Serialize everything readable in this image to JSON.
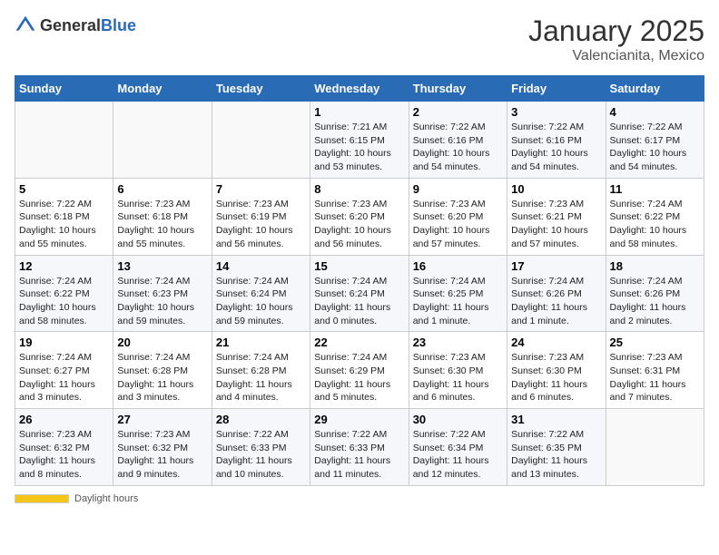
{
  "header": {
    "logo_general": "General",
    "logo_blue": "Blue",
    "month": "January 2025",
    "location": "Valencianita, Mexico"
  },
  "days_of_week": [
    "Sunday",
    "Monday",
    "Tuesday",
    "Wednesday",
    "Thursday",
    "Friday",
    "Saturday"
  ],
  "weeks": [
    [
      {
        "day": "",
        "sunrise": "",
        "sunset": "",
        "daylight": ""
      },
      {
        "day": "",
        "sunrise": "",
        "sunset": "",
        "daylight": ""
      },
      {
        "day": "",
        "sunrise": "",
        "sunset": "",
        "daylight": ""
      },
      {
        "day": "1",
        "sunrise": "7:21 AM",
        "sunset": "6:15 PM",
        "daylight": "10 hours and 53 minutes."
      },
      {
        "day": "2",
        "sunrise": "7:22 AM",
        "sunset": "6:16 PM",
        "daylight": "10 hours and 54 minutes."
      },
      {
        "day": "3",
        "sunrise": "7:22 AM",
        "sunset": "6:16 PM",
        "daylight": "10 hours and 54 minutes."
      },
      {
        "day": "4",
        "sunrise": "7:22 AM",
        "sunset": "6:17 PM",
        "daylight": "10 hours and 54 minutes."
      }
    ],
    [
      {
        "day": "5",
        "sunrise": "7:22 AM",
        "sunset": "6:18 PM",
        "daylight": "10 hours and 55 minutes."
      },
      {
        "day": "6",
        "sunrise": "7:23 AM",
        "sunset": "6:18 PM",
        "daylight": "10 hours and 55 minutes."
      },
      {
        "day": "7",
        "sunrise": "7:23 AM",
        "sunset": "6:19 PM",
        "daylight": "10 hours and 56 minutes."
      },
      {
        "day": "8",
        "sunrise": "7:23 AM",
        "sunset": "6:20 PM",
        "daylight": "10 hours and 56 minutes."
      },
      {
        "day": "9",
        "sunrise": "7:23 AM",
        "sunset": "6:20 PM",
        "daylight": "10 hours and 57 minutes."
      },
      {
        "day": "10",
        "sunrise": "7:23 AM",
        "sunset": "6:21 PM",
        "daylight": "10 hours and 57 minutes."
      },
      {
        "day": "11",
        "sunrise": "7:24 AM",
        "sunset": "6:22 PM",
        "daylight": "10 hours and 58 minutes."
      }
    ],
    [
      {
        "day": "12",
        "sunrise": "7:24 AM",
        "sunset": "6:22 PM",
        "daylight": "10 hours and 58 minutes."
      },
      {
        "day": "13",
        "sunrise": "7:24 AM",
        "sunset": "6:23 PM",
        "daylight": "10 hours and 59 minutes."
      },
      {
        "day": "14",
        "sunrise": "7:24 AM",
        "sunset": "6:24 PM",
        "daylight": "10 hours and 59 minutes."
      },
      {
        "day": "15",
        "sunrise": "7:24 AM",
        "sunset": "6:24 PM",
        "daylight": "11 hours and 0 minutes."
      },
      {
        "day": "16",
        "sunrise": "7:24 AM",
        "sunset": "6:25 PM",
        "daylight": "11 hours and 1 minute."
      },
      {
        "day": "17",
        "sunrise": "7:24 AM",
        "sunset": "6:26 PM",
        "daylight": "11 hours and 1 minute."
      },
      {
        "day": "18",
        "sunrise": "7:24 AM",
        "sunset": "6:26 PM",
        "daylight": "11 hours and 2 minutes."
      }
    ],
    [
      {
        "day": "19",
        "sunrise": "7:24 AM",
        "sunset": "6:27 PM",
        "daylight": "11 hours and 3 minutes."
      },
      {
        "day": "20",
        "sunrise": "7:24 AM",
        "sunset": "6:28 PM",
        "daylight": "11 hours and 3 minutes."
      },
      {
        "day": "21",
        "sunrise": "7:24 AM",
        "sunset": "6:28 PM",
        "daylight": "11 hours and 4 minutes."
      },
      {
        "day": "22",
        "sunrise": "7:24 AM",
        "sunset": "6:29 PM",
        "daylight": "11 hours and 5 minutes."
      },
      {
        "day": "23",
        "sunrise": "7:23 AM",
        "sunset": "6:30 PM",
        "daylight": "11 hours and 6 minutes."
      },
      {
        "day": "24",
        "sunrise": "7:23 AM",
        "sunset": "6:30 PM",
        "daylight": "11 hours and 6 minutes."
      },
      {
        "day": "25",
        "sunrise": "7:23 AM",
        "sunset": "6:31 PM",
        "daylight": "11 hours and 7 minutes."
      }
    ],
    [
      {
        "day": "26",
        "sunrise": "7:23 AM",
        "sunset": "6:32 PM",
        "daylight": "11 hours and 8 minutes."
      },
      {
        "day": "27",
        "sunrise": "7:23 AM",
        "sunset": "6:32 PM",
        "daylight": "11 hours and 9 minutes."
      },
      {
        "day": "28",
        "sunrise": "7:22 AM",
        "sunset": "6:33 PM",
        "daylight": "11 hours and 10 minutes."
      },
      {
        "day": "29",
        "sunrise": "7:22 AM",
        "sunset": "6:33 PM",
        "daylight": "11 hours and 11 minutes."
      },
      {
        "day": "30",
        "sunrise": "7:22 AM",
        "sunset": "6:34 PM",
        "daylight": "11 hours and 12 minutes."
      },
      {
        "day": "31",
        "sunrise": "7:22 AM",
        "sunset": "6:35 PM",
        "daylight": "11 hours and 13 minutes."
      },
      {
        "day": "",
        "sunrise": "",
        "sunset": "",
        "daylight": ""
      }
    ]
  ],
  "footer": {
    "daylight_label": "Daylight hours"
  }
}
